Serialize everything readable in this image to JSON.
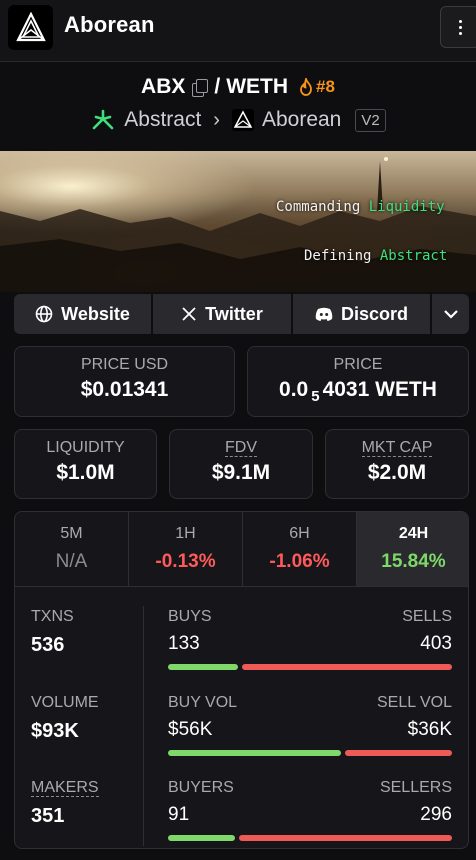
{
  "app": {
    "title": "Aborean",
    "logo_icon": "aborean-logo-icon",
    "menu_icon": "vertical-dots-icon"
  },
  "pair": {
    "base": "ABX",
    "separator": "/",
    "quote": "WETH",
    "rank": "#8",
    "rank_color": "#f7931a"
  },
  "chain": {
    "name": "Abstract",
    "dex": "Aborean",
    "version": "V2",
    "chain_color": "#3ee07a"
  },
  "banner": {
    "line1_prefix": "Commanding ",
    "line1_highlight": "Liquidity",
    "line2_prefix": "Defining ",
    "line2_highlight": "Abstract"
  },
  "links": {
    "website": "Website",
    "twitter": "Twitter",
    "discord": "Discord"
  },
  "price": {
    "usd_label": "PRICE USD",
    "usd_value": "$0.01341",
    "native_label": "PRICE",
    "native_prefix": "0.0",
    "native_sub": "5",
    "native_rest": "4031 WETH"
  },
  "metrics": {
    "liquidity_label": "LIQUIDITY",
    "liquidity_value": "$1.0M",
    "fdv_label": "FDV",
    "fdv_value": "$9.1M",
    "mcap_label": "MKT CAP",
    "mcap_value": "$2.0M"
  },
  "tabs": [
    {
      "label": "5M",
      "value": "N/A"
    },
    {
      "label": "1H",
      "value": "-0.13%"
    },
    {
      "label": "6H",
      "value": "-1.06%"
    },
    {
      "label": "24H",
      "value": "15.84%"
    }
  ],
  "stats": {
    "txns_label": "TXNS",
    "txns_value": "536",
    "volume_label": "VOLUME",
    "volume_value": "$93K",
    "makers_label": "MAKERS",
    "makers_value": "351",
    "buys_label": "BUYS",
    "buys_value": "133",
    "sells_label": "SELLS",
    "sells_value": "403",
    "buyvol_label": "BUY VOL",
    "buyvol_value": "$56K",
    "sellvol_label": "SELL VOL",
    "sellvol_value": "$36K",
    "buyers_label": "BUYERS",
    "buyers_value": "91",
    "sellers_label": "SELLERS",
    "sellers_value": "296",
    "buy_ratio": 0.248,
    "buyvol_ratio": 0.609,
    "buyers_ratio": 0.235,
    "buy_color": "#7fd86a",
    "sell_color": "#ee5a55"
  }
}
